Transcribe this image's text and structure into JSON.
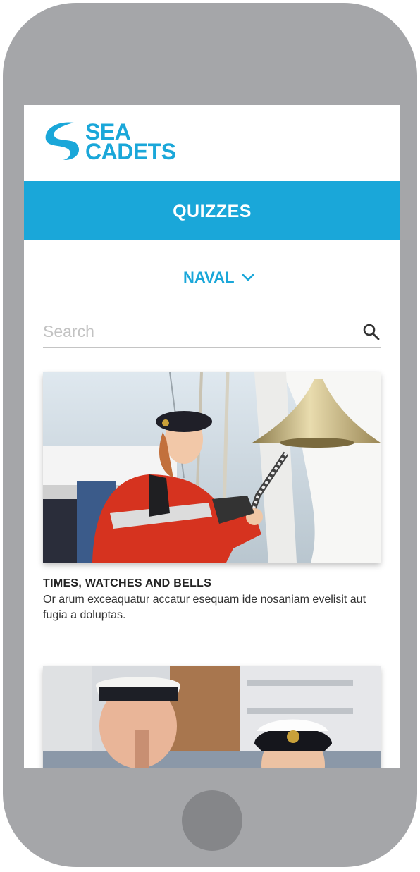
{
  "app": {
    "logo_line1": "SEA",
    "logo_line2": "CADETS"
  },
  "header": {
    "title": "QUIZZES"
  },
  "filter": {
    "selected": "NAVAL"
  },
  "search": {
    "placeholder": "Search"
  },
  "quizzes": [
    {
      "title": "TIMES, WATCHES AND BELLS",
      "description": "Or arum exceaquatur accatur esequam ide nosaniam evelisit aut fugia a doluptas."
    }
  ],
  "colors": {
    "brand": "#1aa7d9",
    "device": "#a5a6a9"
  },
  "icons": [
    "sea-cadets-logo-icon",
    "chevron-down-icon",
    "search-icon"
  ]
}
